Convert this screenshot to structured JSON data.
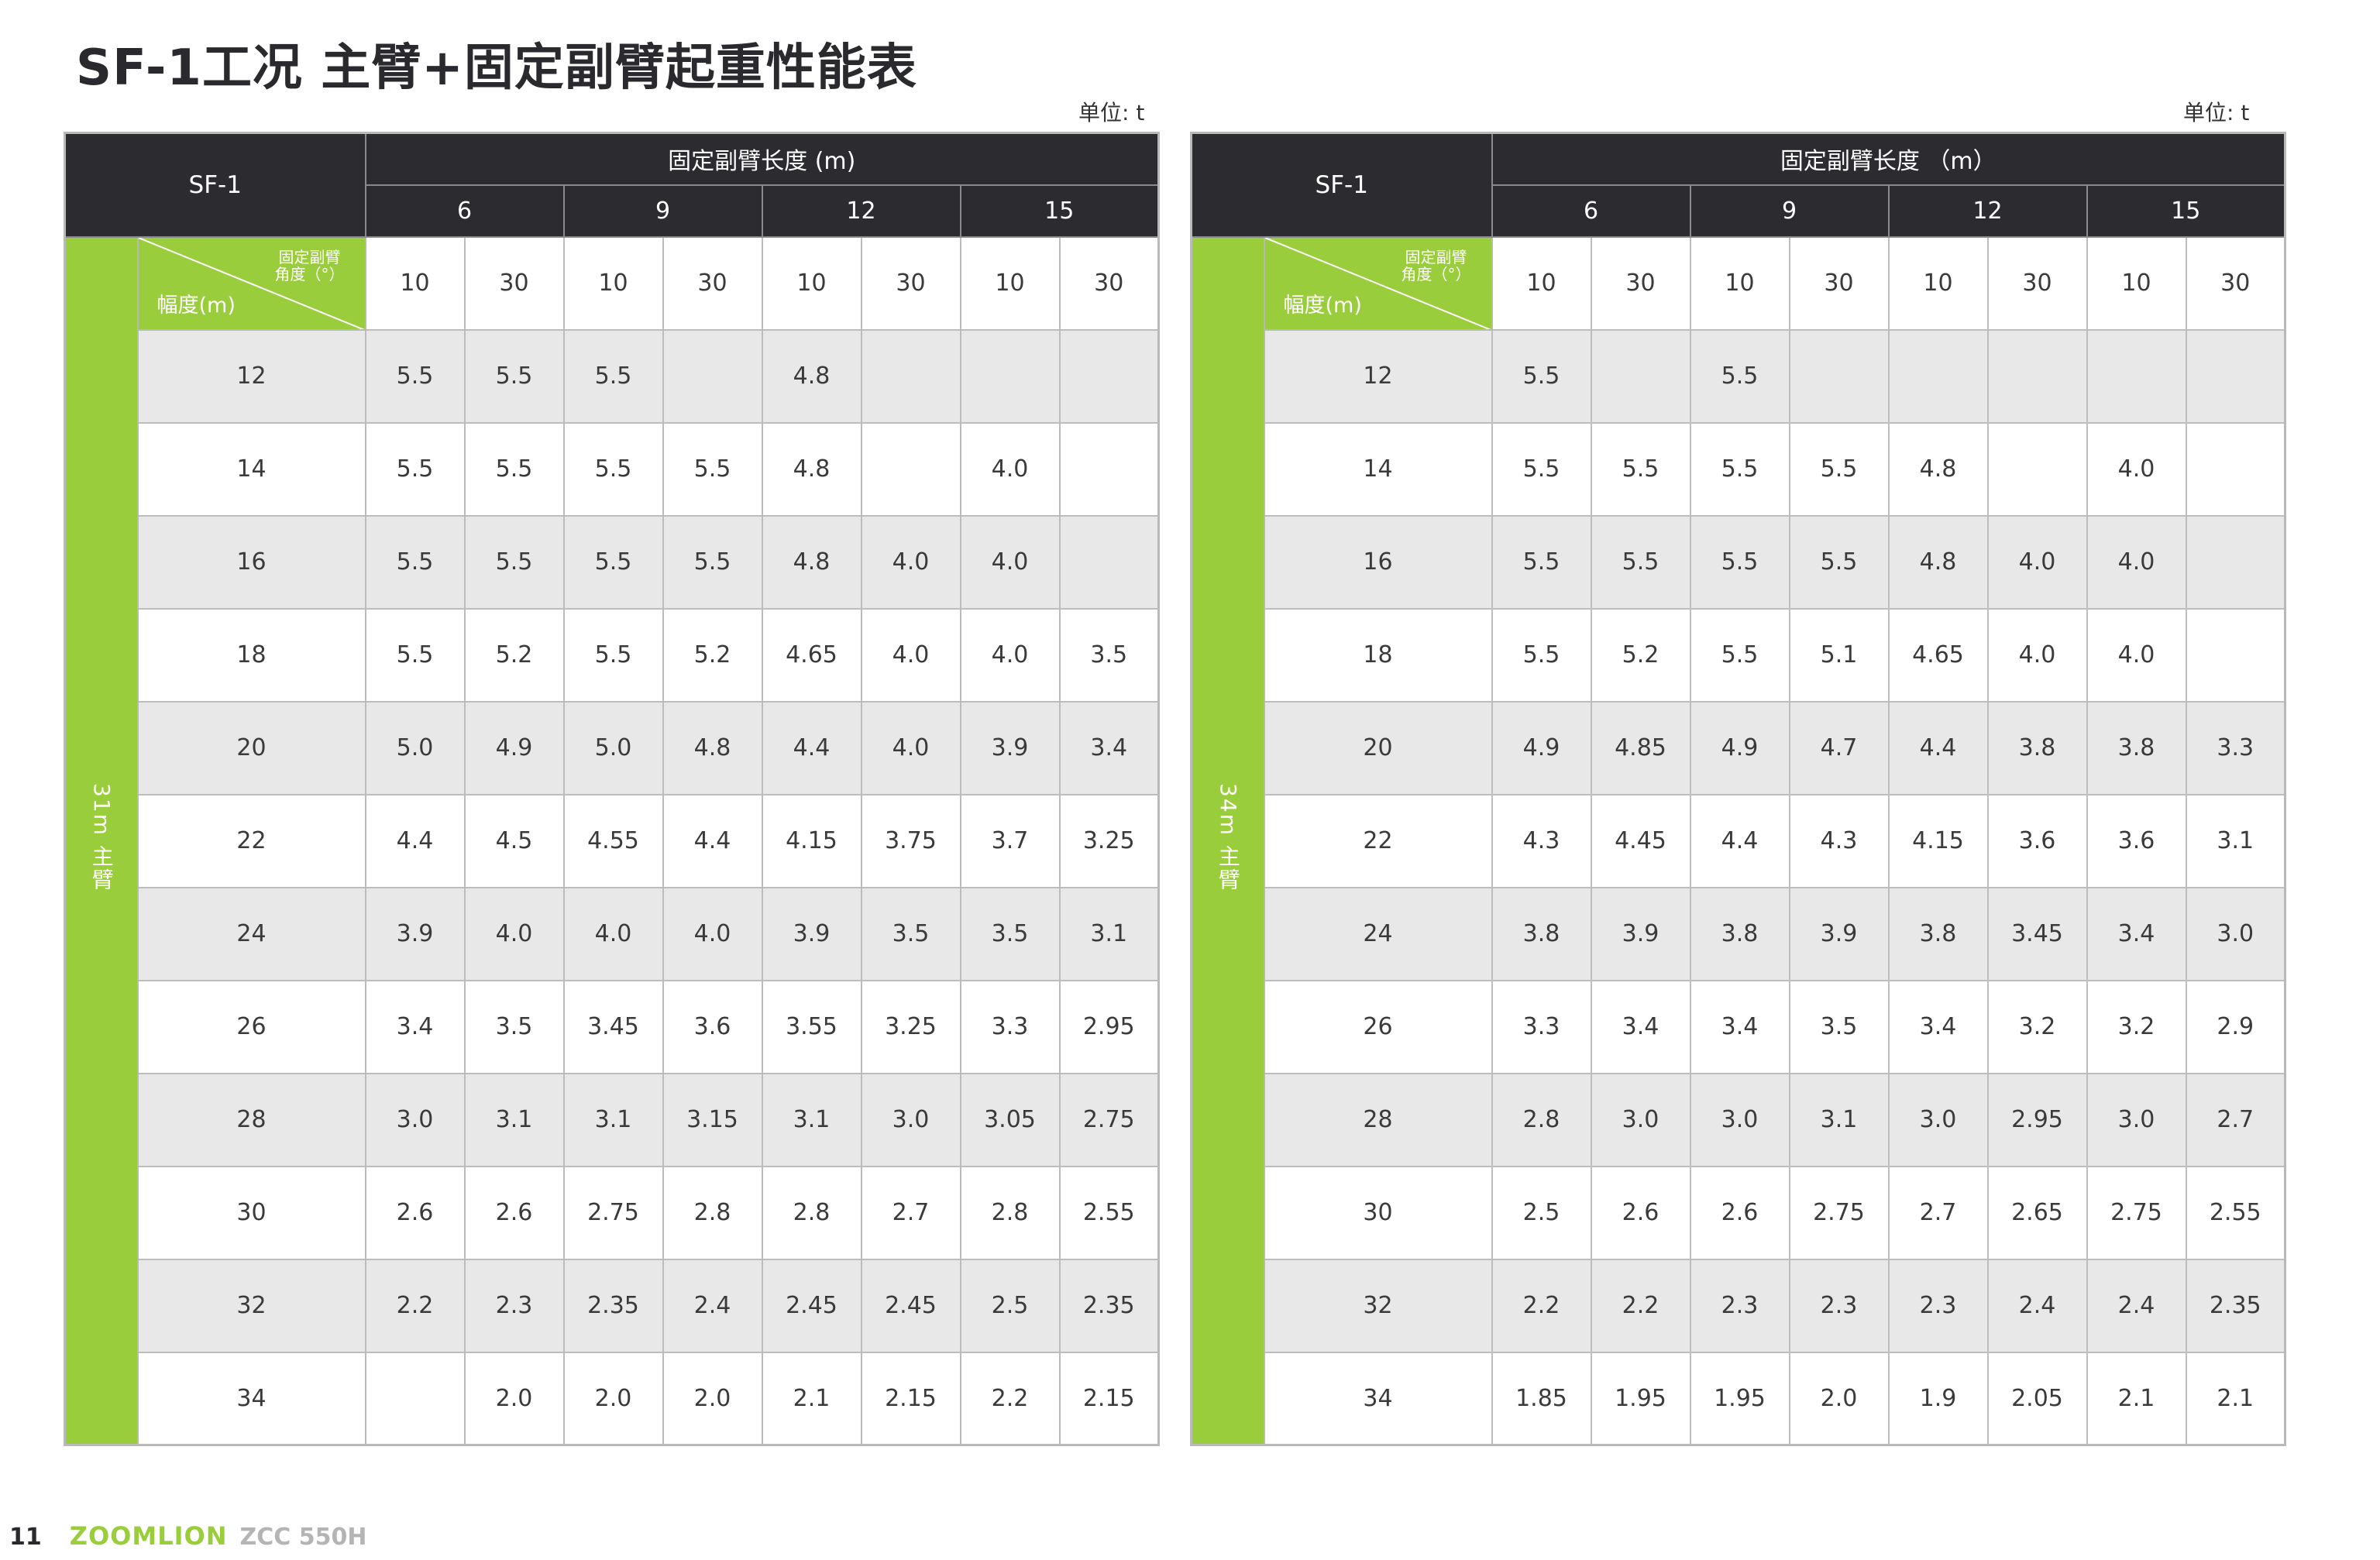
{
  "title": "SF-1工况  主臂+固定副臂起重性能表",
  "unit": "单位: t",
  "footer": {
    "page": "11",
    "brand": "ZOOMLION",
    "model": "ZCC 550H"
  },
  "tables": [
    {
      "corner": "SF-1",
      "header": "固定副臂长度 (m)",
      "jib_lengths": [
        "6",
        "9",
        "12",
        "15"
      ],
      "angles": [
        "10",
        "30",
        "10",
        "30",
        "10",
        "30",
        "10",
        "30"
      ],
      "diag_top": "固定副臂\n角度（°）",
      "diag_bottom": "幅度(m)",
      "side": "31m 主臂",
      "rows": [
        {
          "r": "12",
          "v": [
            "5.5",
            "5.5",
            "5.5",
            "",
            "4.8",
            "",
            "",
            ""
          ]
        },
        {
          "r": "14",
          "v": [
            "5.5",
            "5.5",
            "5.5",
            "5.5",
            "4.8",
            "",
            "4.0",
            ""
          ]
        },
        {
          "r": "16",
          "v": [
            "5.5",
            "5.5",
            "5.5",
            "5.5",
            "4.8",
            "4.0",
            "4.0",
            ""
          ]
        },
        {
          "r": "18",
          "v": [
            "5.5",
            "5.2",
            "5.5",
            "5.2",
            "4.65",
            "4.0",
            "4.0",
            "3.5"
          ]
        },
        {
          "r": "20",
          "v": [
            "5.0",
            "4.9",
            "5.0",
            "4.8",
            "4.4",
            "4.0",
            "3.9",
            "3.4"
          ]
        },
        {
          "r": "22",
          "v": [
            "4.4",
            "4.5",
            "4.55",
            "4.4",
            "4.15",
            "3.75",
            "3.7",
            "3.25"
          ]
        },
        {
          "r": "24",
          "v": [
            "3.9",
            "4.0",
            "4.0",
            "4.0",
            "3.9",
            "3.5",
            "3.5",
            "3.1"
          ]
        },
        {
          "r": "26",
          "v": [
            "3.4",
            "3.5",
            "3.45",
            "3.6",
            "3.55",
            "3.25",
            "3.3",
            "2.95"
          ]
        },
        {
          "r": "28",
          "v": [
            "3.0",
            "3.1",
            "3.1",
            "3.15",
            "3.1",
            "3.0",
            "3.05",
            "2.75"
          ]
        },
        {
          "r": "30",
          "v": [
            "2.6",
            "2.6",
            "2.75",
            "2.8",
            "2.8",
            "2.7",
            "2.8",
            "2.55"
          ]
        },
        {
          "r": "32",
          "v": [
            "2.2",
            "2.3",
            "2.35",
            "2.4",
            "2.45",
            "2.45",
            "2.5",
            "2.35"
          ]
        },
        {
          "r": "34",
          "v": [
            "",
            "2.0",
            "2.0",
            "2.0",
            "2.1",
            "2.15",
            "2.2",
            "2.15"
          ]
        }
      ]
    },
    {
      "corner": "SF-1",
      "header": "固定副臂长度 （m）",
      "jib_lengths": [
        "6",
        "9",
        "12",
        "15"
      ],
      "angles": [
        "10",
        "30",
        "10",
        "30",
        "10",
        "30",
        "10",
        "30"
      ],
      "diag_top": "固定副臂\n角度（°）",
      "diag_bottom": "幅度(m)",
      "side": "34m 主臂",
      "rows": [
        {
          "r": "12",
          "v": [
            "5.5",
            "",
            "5.5",
            "",
            "",
            "",
            "",
            ""
          ]
        },
        {
          "r": "14",
          "v": [
            "5.5",
            "5.5",
            "5.5",
            "5.5",
            "4.8",
            "",
            "4.0",
            ""
          ]
        },
        {
          "r": "16",
          "v": [
            "5.5",
            "5.5",
            "5.5",
            "5.5",
            "4.8",
            "4.0",
            "4.0",
            ""
          ]
        },
        {
          "r": "18",
          "v": [
            "5.5",
            "5.2",
            "5.5",
            "5.1",
            "4.65",
            "4.0",
            "4.0",
            ""
          ]
        },
        {
          "r": "20",
          "v": [
            "4.9",
            "4.85",
            "4.9",
            "4.7",
            "4.4",
            "3.8",
            "3.8",
            "3.3"
          ]
        },
        {
          "r": "22",
          "v": [
            "4.3",
            "4.45",
            "4.4",
            "4.3",
            "4.15",
            "3.6",
            "3.6",
            "3.1"
          ]
        },
        {
          "r": "24",
          "v": [
            "3.8",
            "3.9",
            "3.8",
            "3.9",
            "3.8",
            "3.45",
            "3.4",
            "3.0"
          ]
        },
        {
          "r": "26",
          "v": [
            "3.3",
            "3.4",
            "3.4",
            "3.5",
            "3.4",
            "3.2",
            "3.2",
            "2.9"
          ]
        },
        {
          "r": "28",
          "v": [
            "2.8",
            "3.0",
            "3.0",
            "3.1",
            "3.0",
            "2.95",
            "3.0",
            "2.7"
          ]
        },
        {
          "r": "30",
          "v": [
            "2.5",
            "2.6",
            "2.6",
            "2.75",
            "2.7",
            "2.65",
            "2.75",
            "2.55"
          ]
        },
        {
          "r": "32",
          "v": [
            "2.2",
            "2.2",
            "2.3",
            "2.3",
            "2.3",
            "2.4",
            "2.4",
            "2.35"
          ]
        },
        {
          "r": "34",
          "v": [
            "1.85",
            "1.95",
            "1.95",
            "2.0",
            "1.9",
            "2.05",
            "2.1",
            "2.1"
          ]
        }
      ]
    }
  ]
}
